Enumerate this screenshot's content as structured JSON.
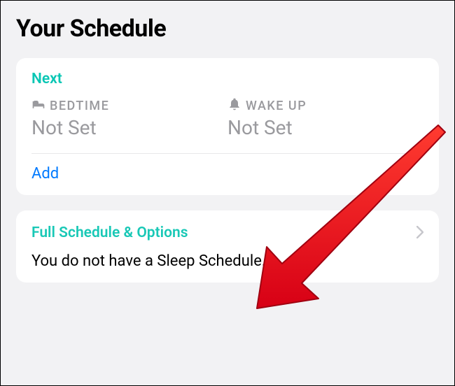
{
  "title": "Your Schedule",
  "next_card": {
    "header": "Next",
    "bedtime": {
      "label": "BEDTIME",
      "value": "Not Set"
    },
    "wakeup": {
      "label": "WAKE UP",
      "value": "Not Set"
    },
    "add_label": "Add"
  },
  "full_card": {
    "header": "Full Schedule & Options",
    "status": "You do not have a Sleep Schedule."
  }
}
